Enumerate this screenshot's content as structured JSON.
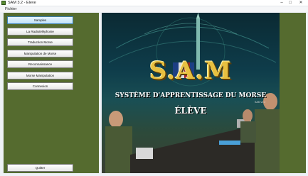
{
  "window": {
    "title": "SAM 3.2 - Eleve",
    "controls": [
      "–",
      "□",
      "✕"
    ]
  },
  "menu": {
    "items": [
      "Fichier"
    ]
  },
  "nav": {
    "items": [
      "Samples",
      "La Radiotéléphonie",
      "Traduction Morse",
      "Manipulation de Morse",
      "Reconnaissance",
      "Morse Manipulation",
      "Connexion"
    ],
    "selected_index": 0,
    "quit_label": "Quitter"
  },
  "splash": {
    "logo": "S.A.M",
    "subtitle": "SYSTÈME D'APPRENTISSAGE DU MORSE",
    "role": "ÉLÈVE",
    "version": "SAM v3.2"
  },
  "colors": {
    "panel": "#556b2f",
    "selected_button": "#c3e3f8",
    "logo": "#e8c040"
  }
}
